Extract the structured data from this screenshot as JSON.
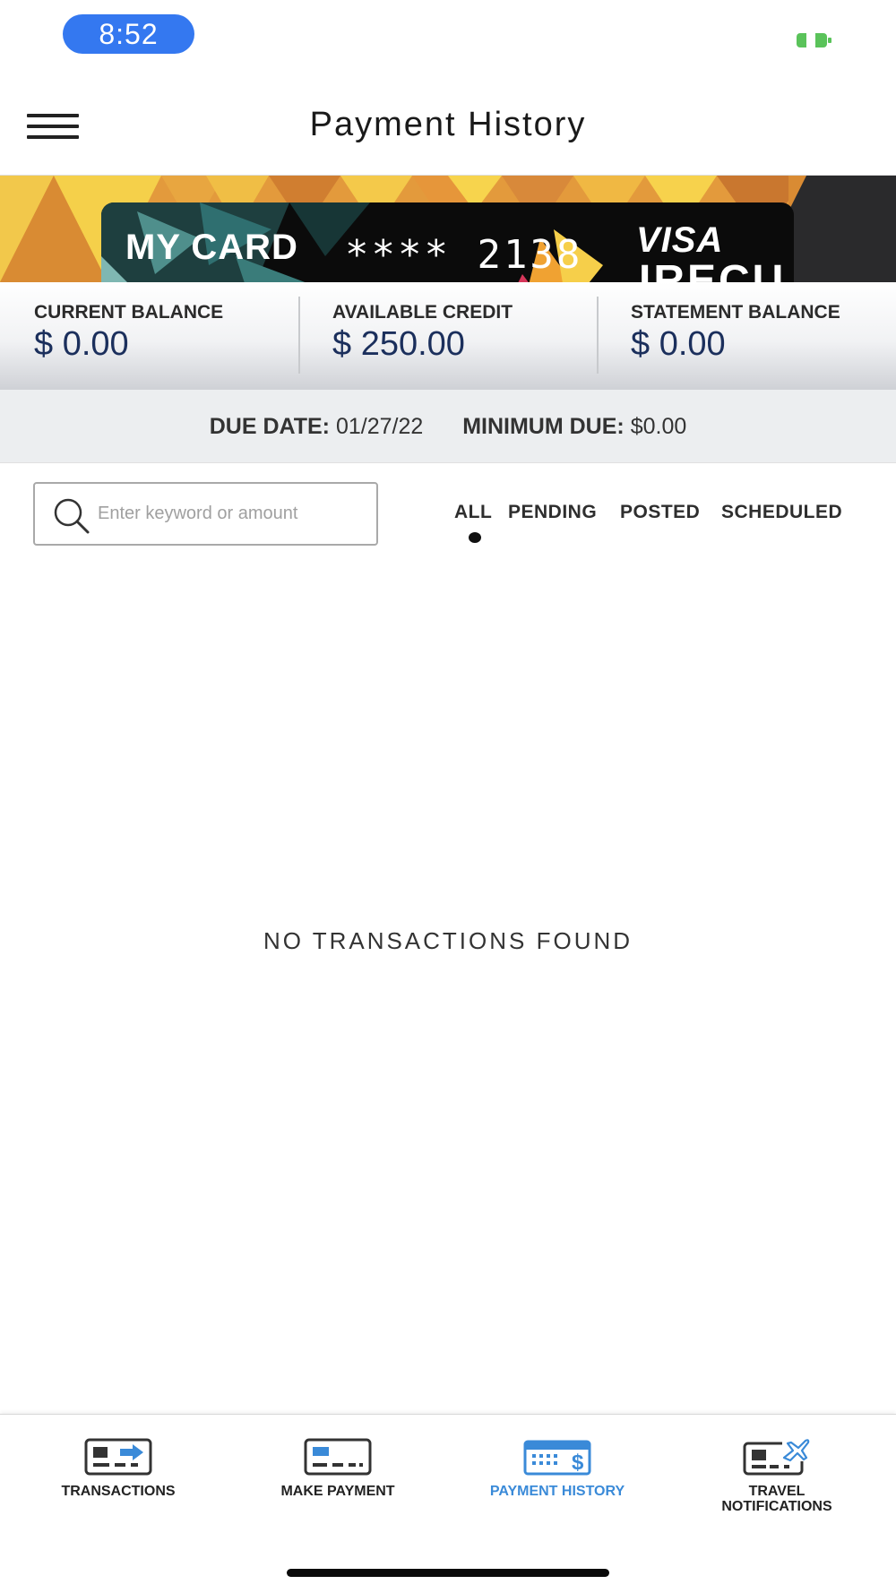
{
  "status_bar": {
    "time": "8:52",
    "battery_color": "#5ac35a",
    "time_pill_color": "#3478f0"
  },
  "header": {
    "title": "Payment History",
    "menu_icon": "hamburger-menu-icon"
  },
  "card": {
    "name": "MY CARD",
    "masked_number": "**** 2138",
    "network": "VISA",
    "issuer": "IRECU"
  },
  "balances": [
    {
      "label": "CURRENT BALANCE",
      "value": "$ 0.00"
    },
    {
      "label": "AVAILABLE CREDIT",
      "value": "$ 250.00"
    },
    {
      "label": "STATEMENT BALANCE",
      "value": "$ 0.00"
    }
  ],
  "due": {
    "due_date_label": "DUE DATE:",
    "due_date_value": "01/27/22",
    "minimum_due_label": "MINIMUM DUE:",
    "minimum_due_value": "$0.00"
  },
  "search": {
    "placeholder": "Enter keyword or amount",
    "value": ""
  },
  "filters": {
    "selected": "ALL",
    "tabs": [
      "ALL",
      "PENDING",
      "POSTED",
      "SCHEDULED"
    ]
  },
  "empty_message": "NO TRANSACTIONS FOUND",
  "bottom_nav": {
    "active_color": "#3a8ad8",
    "items": [
      {
        "label": "TRANSACTIONS",
        "icon": "transactions-card-arrow-icon"
      },
      {
        "label": "MAKE PAYMENT",
        "icon": "make-payment-card-icon"
      },
      {
        "label": "PAYMENT HISTORY",
        "icon": "payment-history-calendar-dollar-icon",
        "active": true
      },
      {
        "label_line1": "TRAVEL",
        "label_line2": "NOTIFICATIONS",
        "icon": "travel-notifications-plane-icon"
      }
    ]
  }
}
